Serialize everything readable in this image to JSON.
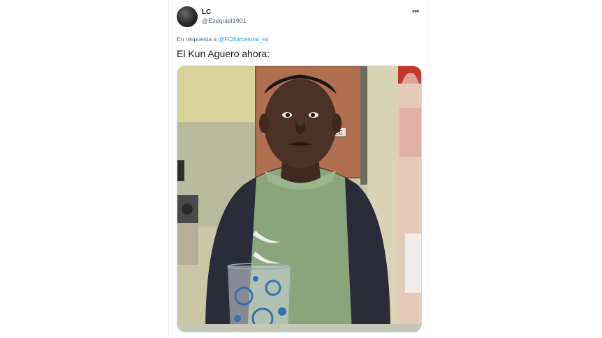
{
  "tweet": {
    "display_name": "LC",
    "handle": "@Ezequiel1901",
    "more_icon": "more-horizontal-icon",
    "reply_prefix": "En respuesta a",
    "reply_mention": "@FCBarcelona_es",
    "text": "El Kun Aguero ahora:"
  },
  "media": {
    "door_sign": "CUTEC"
  },
  "colors": {
    "link": "#1d9bf0",
    "text": "#0f1419",
    "secondary": "#536471"
  }
}
